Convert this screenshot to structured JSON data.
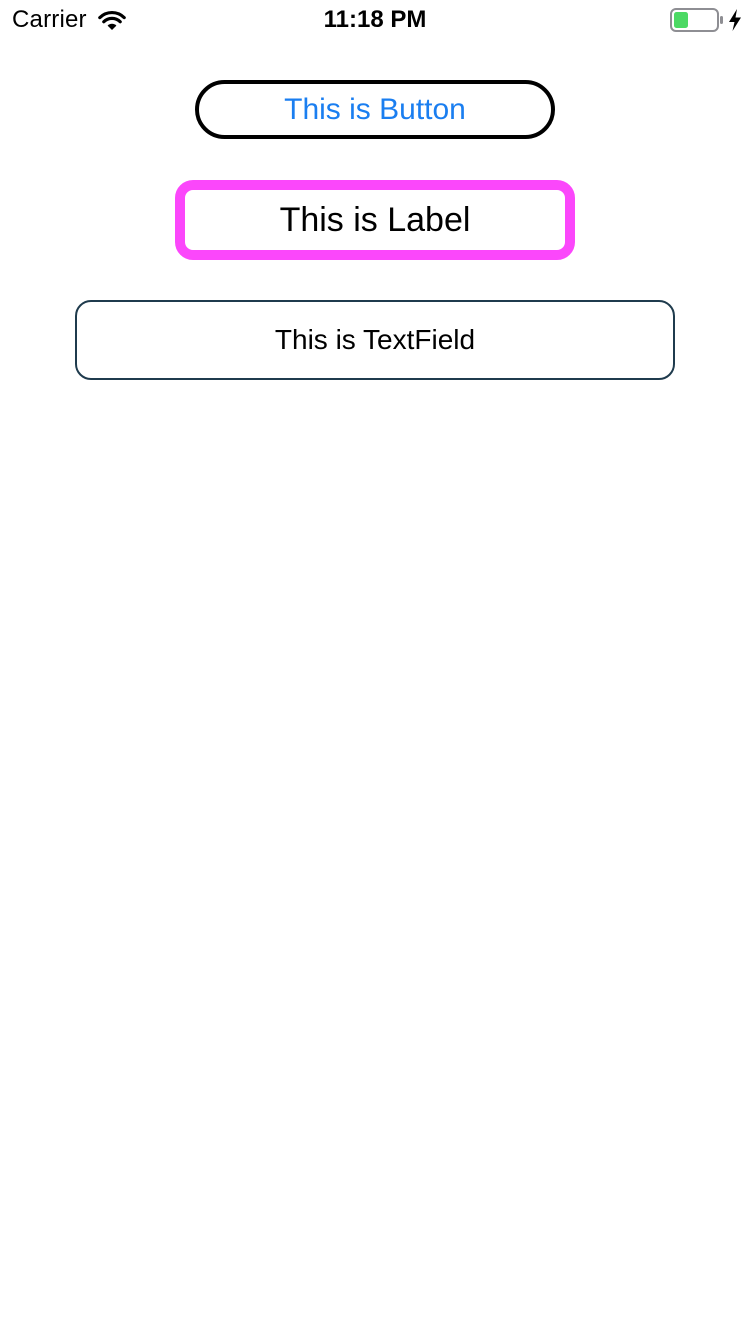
{
  "status_bar": {
    "carrier": "Carrier",
    "time": "11:18 PM",
    "icons": {
      "wifi": "wifi-icon",
      "battery": "battery-icon",
      "charging": "charging-bolt-icon"
    },
    "battery_level": 0.35,
    "battery_color": "#4cd964"
  },
  "main": {
    "button": {
      "label": "This is Button",
      "text_color": "#1a7ef0",
      "border_color": "#000000"
    },
    "label": {
      "text": "This is Label",
      "border_color": "#fb47fb"
    },
    "textfield": {
      "value": "This is TextField",
      "border_color": "#1f3b4d"
    }
  }
}
